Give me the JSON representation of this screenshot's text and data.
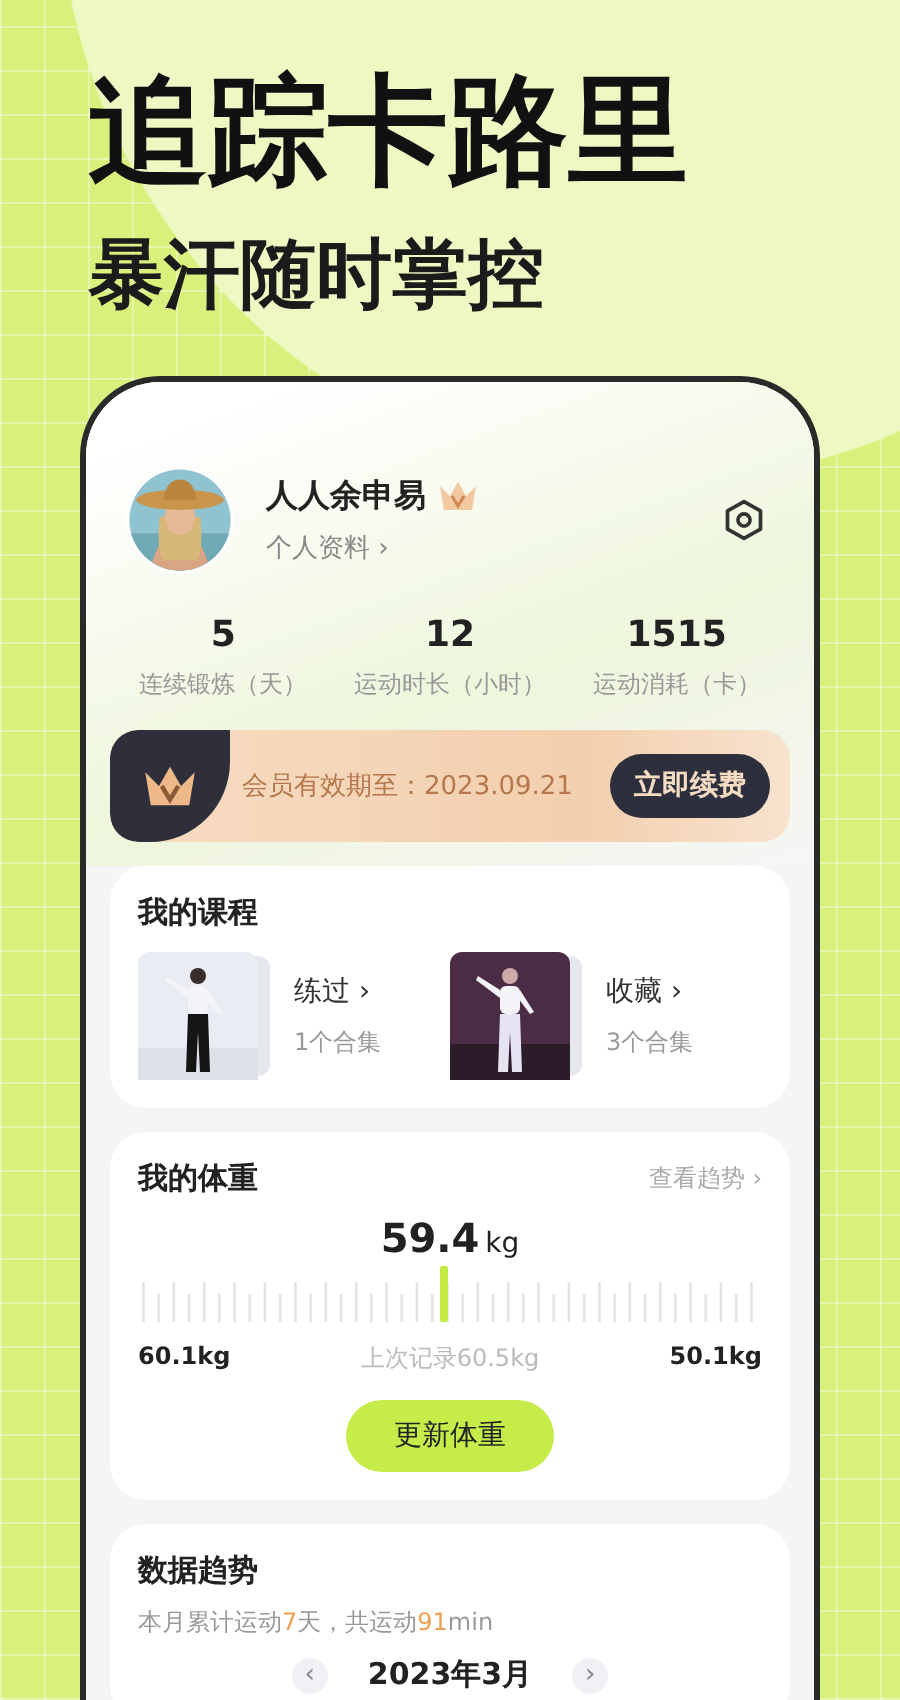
{
  "headline": "追踪卡路里",
  "subheadline": "暴汗随时掌控",
  "profile": {
    "name": "人人余申易",
    "vip": true,
    "link": "个人资料 ›"
  },
  "stats": [
    {
      "value": "5",
      "label": "连续锻炼（天）"
    },
    {
      "value": "12",
      "label": "运动时长（小时）"
    },
    {
      "value": "1515",
      "label": "运动消耗（卡）"
    }
  ],
  "membership": {
    "text": "会员有效期至：2023.09.21",
    "button": "立即续费"
  },
  "courses": {
    "title": "我的课程",
    "items": [
      {
        "name": "练过 ›",
        "count": "1个合集"
      },
      {
        "name": "收藏 ›",
        "count": "3个合集"
      }
    ]
  },
  "weight": {
    "title": "我的体重",
    "link": "查看趋势 ›",
    "value": "59.4",
    "unit": "kg",
    "left": "60.1kg",
    "last": "上次记录60.5kg",
    "right": "50.1kg",
    "button": "更新体重"
  },
  "trend": {
    "title": "数据趋势",
    "summary": [
      {
        "text": "本月累计运动",
        "highlight": false
      },
      {
        "text": "7",
        "highlight": true
      },
      {
        "text": "天，共运动",
        "highlight": false
      },
      {
        "text": "91",
        "highlight": true
      },
      {
        "text": "min",
        "highlight": false
      }
    ],
    "month": "2023年3月",
    "prev": "‹",
    "next": "›"
  }
}
